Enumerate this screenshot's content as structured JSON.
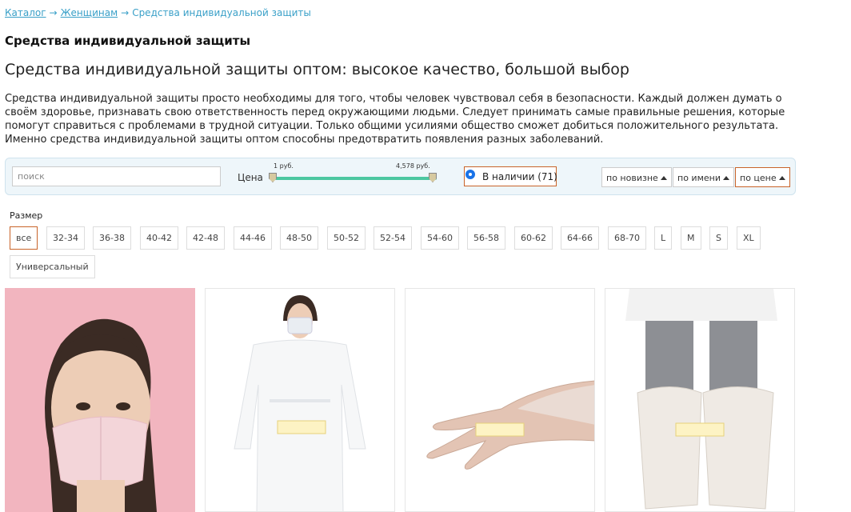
{
  "breadcrumb": {
    "items": [
      "Каталог",
      "Женщинам"
    ],
    "separator": "→",
    "current": "Средства индивидуальной защиты"
  },
  "page": {
    "title": "Средства индивидуальной защиты",
    "subtitle": "Средства индивидуальной защиты оптом: высокое качество, большой выбор",
    "description": "Средства индивидуальной защиты просто необходимы для того, чтобы человек чувствовал себя в безопасности. Каждый должен думать о своём здоровье, признавать свою ответственность перед окружающими людьми. Следует принимать самые правильные решения, которые помогут справиться с проблемами в трудной ситуации. Только общими усилиями общество сможет добиться положительного результата. Именно средства индивидуальной защиты оптом способны предотвратить появления разных заболеваний."
  },
  "filters": {
    "search_placeholder": "поиск",
    "price_label": "Цена",
    "price_min": "1 руб.",
    "price_max": "4,578 руб.",
    "in_stock_label": "В наличии (71)",
    "in_stock_checked": true,
    "sort": [
      {
        "label": "по новизне",
        "active": false
      },
      {
        "label": "по имени",
        "active": false
      },
      {
        "label": "по цене",
        "active": true
      }
    ]
  },
  "sizes": {
    "label": "Размер",
    "options": [
      "все",
      "32-34",
      "36-38",
      "40-42",
      "42-48",
      "44-46",
      "48-50",
      "50-52",
      "52-54",
      "54-60",
      "56-58",
      "60-62",
      "64-66",
      "68-70",
      "L",
      "M",
      "S",
      "XL",
      "Универсальный"
    ],
    "selected": "все"
  },
  "products": [
    {
      "image": "pink-face-mask-photo"
    },
    {
      "image": "white-protective-gown-photo"
    },
    {
      "image": "disposable-gloves-photo"
    },
    {
      "image": "shoe-covers-photo"
    }
  ],
  "colors": {
    "link": "#3aa0c8",
    "accent": "#c9642a",
    "filter_bg": "#eef6fa",
    "slider": "#4cc7a0"
  }
}
